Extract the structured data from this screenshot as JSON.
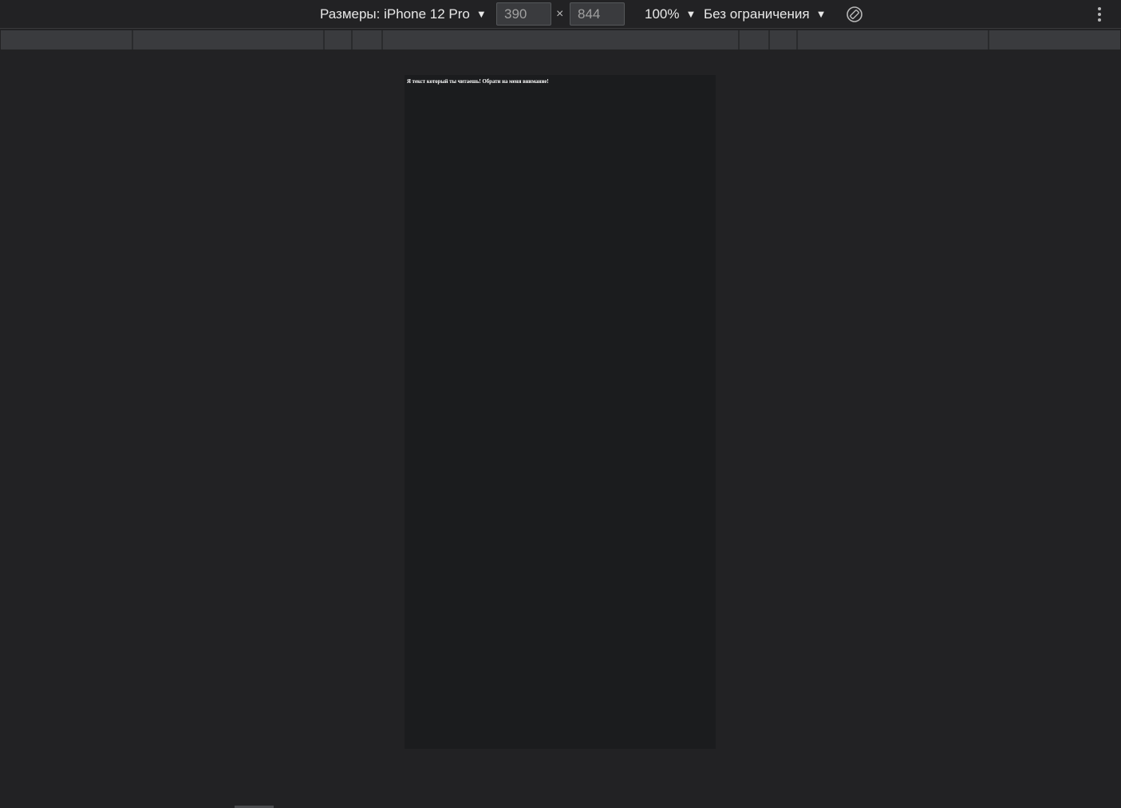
{
  "toolbar": {
    "device_label": "Размеры: iPhone 12 Pro",
    "width_value": "390",
    "height_value": "844",
    "times_symbol": "×",
    "zoom_label": "100%",
    "throttle_label": "Без ограничения",
    "caret_glyph": "▼"
  },
  "icons": {
    "rotate": "rotate-icon",
    "more": "more-vertical-icon"
  },
  "page": {
    "text": "Я текст который ты читаешь! Обрати на меня внимание!"
  },
  "colors": {
    "background": "#222224",
    "input_background": "#3a3b3e",
    "viewport_background": "#1b1c1e",
    "text": "#e8e8e8"
  }
}
